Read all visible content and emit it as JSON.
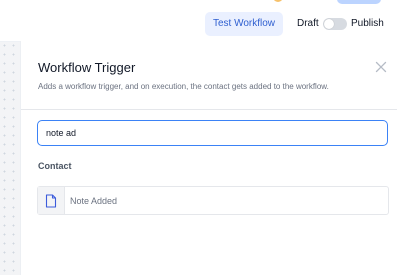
{
  "topbar": {
    "test_workflow_label": "Test Workflow",
    "draft_label": "Draft",
    "publish_label": "Publish",
    "publish_toggle_on": false
  },
  "panel": {
    "title": "Workflow Trigger",
    "subtitle": "Adds a workflow trigger, and on execution, the contact gets added to the workflow.",
    "close_icon": "close-icon",
    "search": {
      "value": "note ad"
    },
    "section_label": "Contact",
    "options": [
      {
        "label": "Note Added",
        "icon": "document-icon"
      }
    ]
  },
  "colors": {
    "accent": "#3b82f6",
    "test_button_bg": "#eaf0ff",
    "test_button_text": "#2f5fd0"
  }
}
